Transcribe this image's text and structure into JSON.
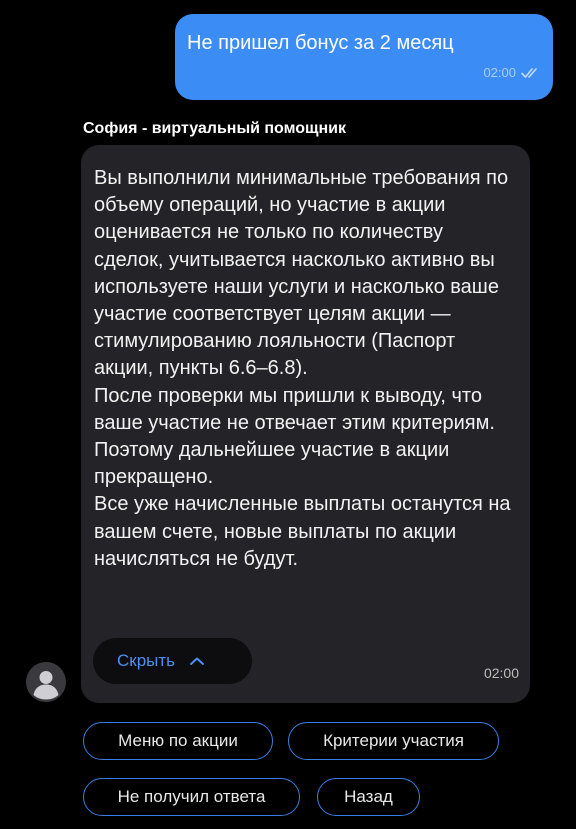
{
  "outgoing": {
    "text": "Не пришел бонус за 2 месяц",
    "time": "02:00",
    "status_icon": "double-check-icon"
  },
  "incoming": {
    "sender": "София - виртуальный помощник",
    "text": "Вы выполнили минимальные требования по объему операций, но участие в акции оценивается не только по количеству сделок, учитывается насколько активно вы используете наши услуги и насколько ваше участие соответствует целям акции — стимулированию лояльности (Паспорт акции, пункты 6.6–6.8).\nПосле проверки мы пришли к выводу, что ваше участие не отвечает этим критериям. Поэтому дальнейшее участие в акции прекращено.\nВсе уже начисленные выплаты останутся на вашем счете, новые выплаты по акции начисляться не будут.",
    "hide_label": "Скрыть",
    "time": "02:00",
    "avatar_icon": "user-avatar-icon"
  },
  "quick_replies": [
    {
      "label": "Меню по акции"
    },
    {
      "label": "Критерии участия"
    },
    {
      "label": "Не получил ответа"
    },
    {
      "label": "Назад"
    }
  ],
  "colors": {
    "background": "#000000",
    "outgoing_bubble": "#3b8df5",
    "incoming_bubble": "#242428",
    "accent": "#4a8ff0",
    "chip_border": "#3a7ee0"
  }
}
